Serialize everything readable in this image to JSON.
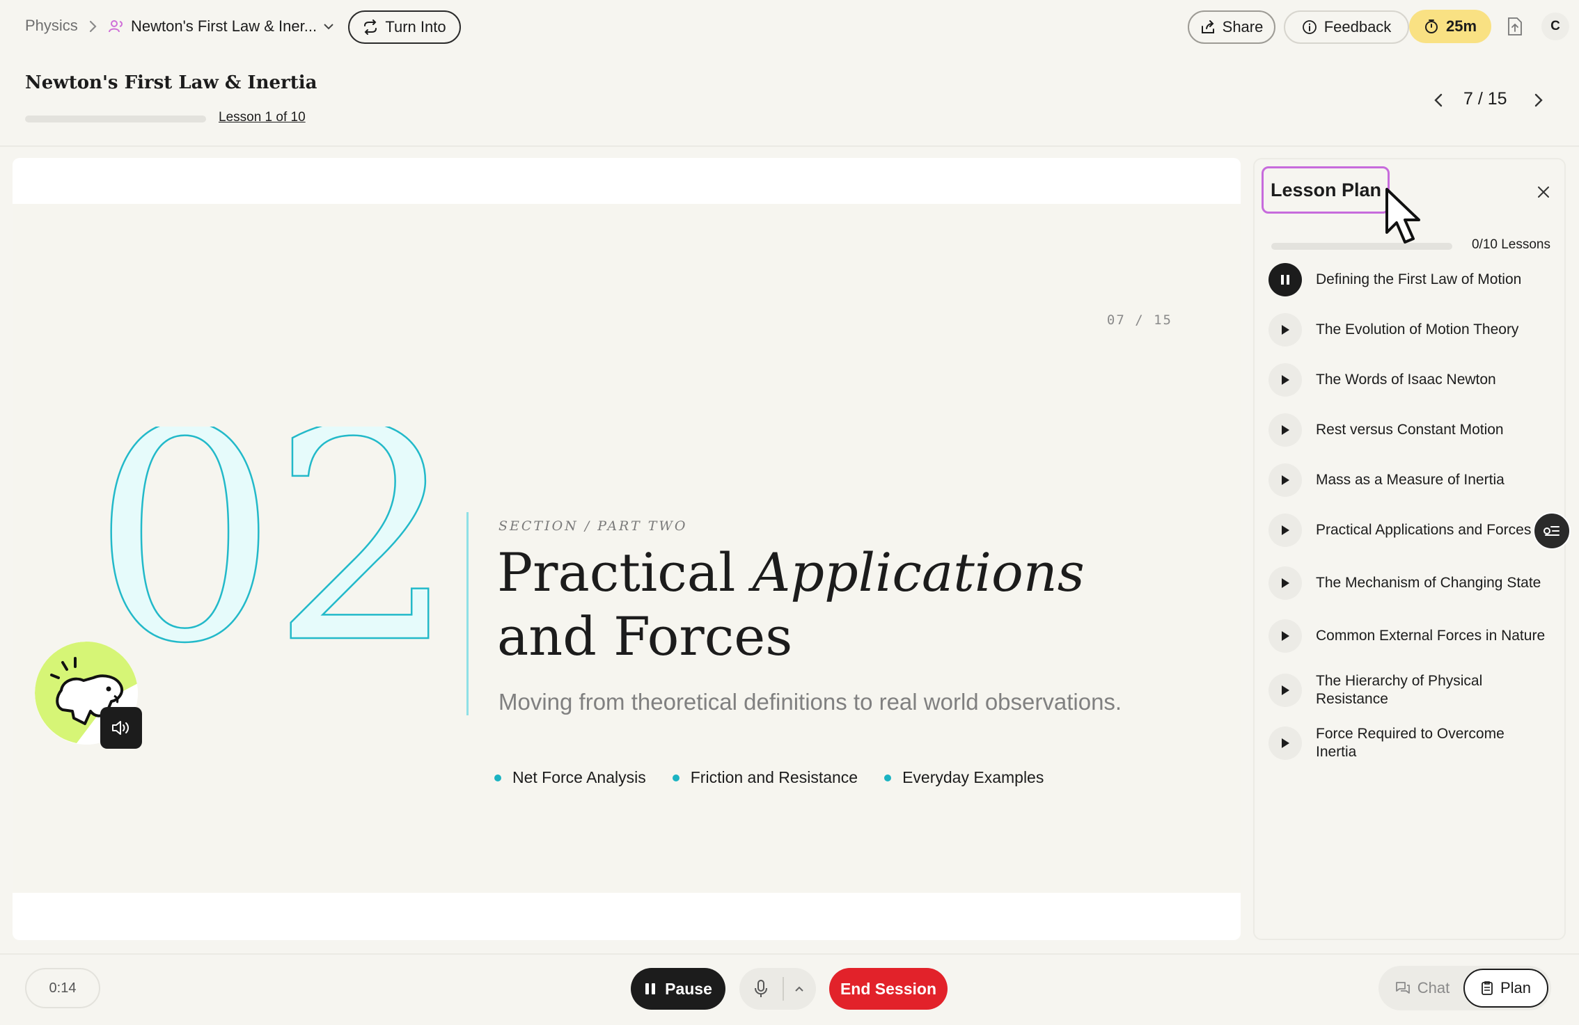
{
  "breadcrumb": {
    "root": "Physics",
    "current": "Newton's First Law & Iner...",
    "turn_into": "Turn Into"
  },
  "toolbar": {
    "share": "Share",
    "feedback": "Feedback",
    "timer": "25m",
    "avatar_initial": "C"
  },
  "lesson": {
    "title": "Newton's First Law & Inertia",
    "progress_fraction": 0.0,
    "link": "Lesson 1 of 10",
    "slide_counter": "7 / 15"
  },
  "slide": {
    "number": "07 / 15",
    "big_number": "02",
    "section_label": "SECTION / PART TWO",
    "title_plain": "Practical ",
    "title_italic": "Applications",
    "title_line2": "and Forces",
    "subtitle": "Moving from theoretical definitions to real world observations.",
    "bullets": [
      "Net Force Analysis",
      "Friction and Resistance",
      "Everyday Examples"
    ],
    "accent_color": "#1bb3c2"
  },
  "plan": {
    "title": "Lesson Plan",
    "count": "0/10 Lessons",
    "progress_fraction": 0.0,
    "items": [
      {
        "label": "Defining the First Law of Motion",
        "state": "playing"
      },
      {
        "label": "The Evolution of Motion Theory",
        "state": "idle"
      },
      {
        "label": "The Words of Isaac Newton",
        "state": "idle"
      },
      {
        "label": "Rest versus Constant Motion",
        "state": "idle"
      },
      {
        "label": "Mass as a Measure of Inertia",
        "state": "idle"
      },
      {
        "label": "Practical Applications and Forces",
        "state": "idle"
      },
      {
        "label": "The Mechanism of Changing State",
        "state": "idle"
      },
      {
        "label": "Common External Forces in Nature",
        "state": "idle"
      },
      {
        "label": "The Hierarchy of Physical Resistance",
        "state": "idle"
      },
      {
        "label": "Force Required to Overcome Inertia",
        "state": "idle"
      }
    ]
  },
  "controls": {
    "elapsed": "0:14",
    "pause": "Pause",
    "end": "End Session",
    "chat": "Chat",
    "plan": "Plan"
  },
  "colors": {
    "end_button": "#e2222a",
    "timer_bg": "#f9e183",
    "mascot_bg": "#d6f576",
    "highlight": "#c76bdc"
  }
}
